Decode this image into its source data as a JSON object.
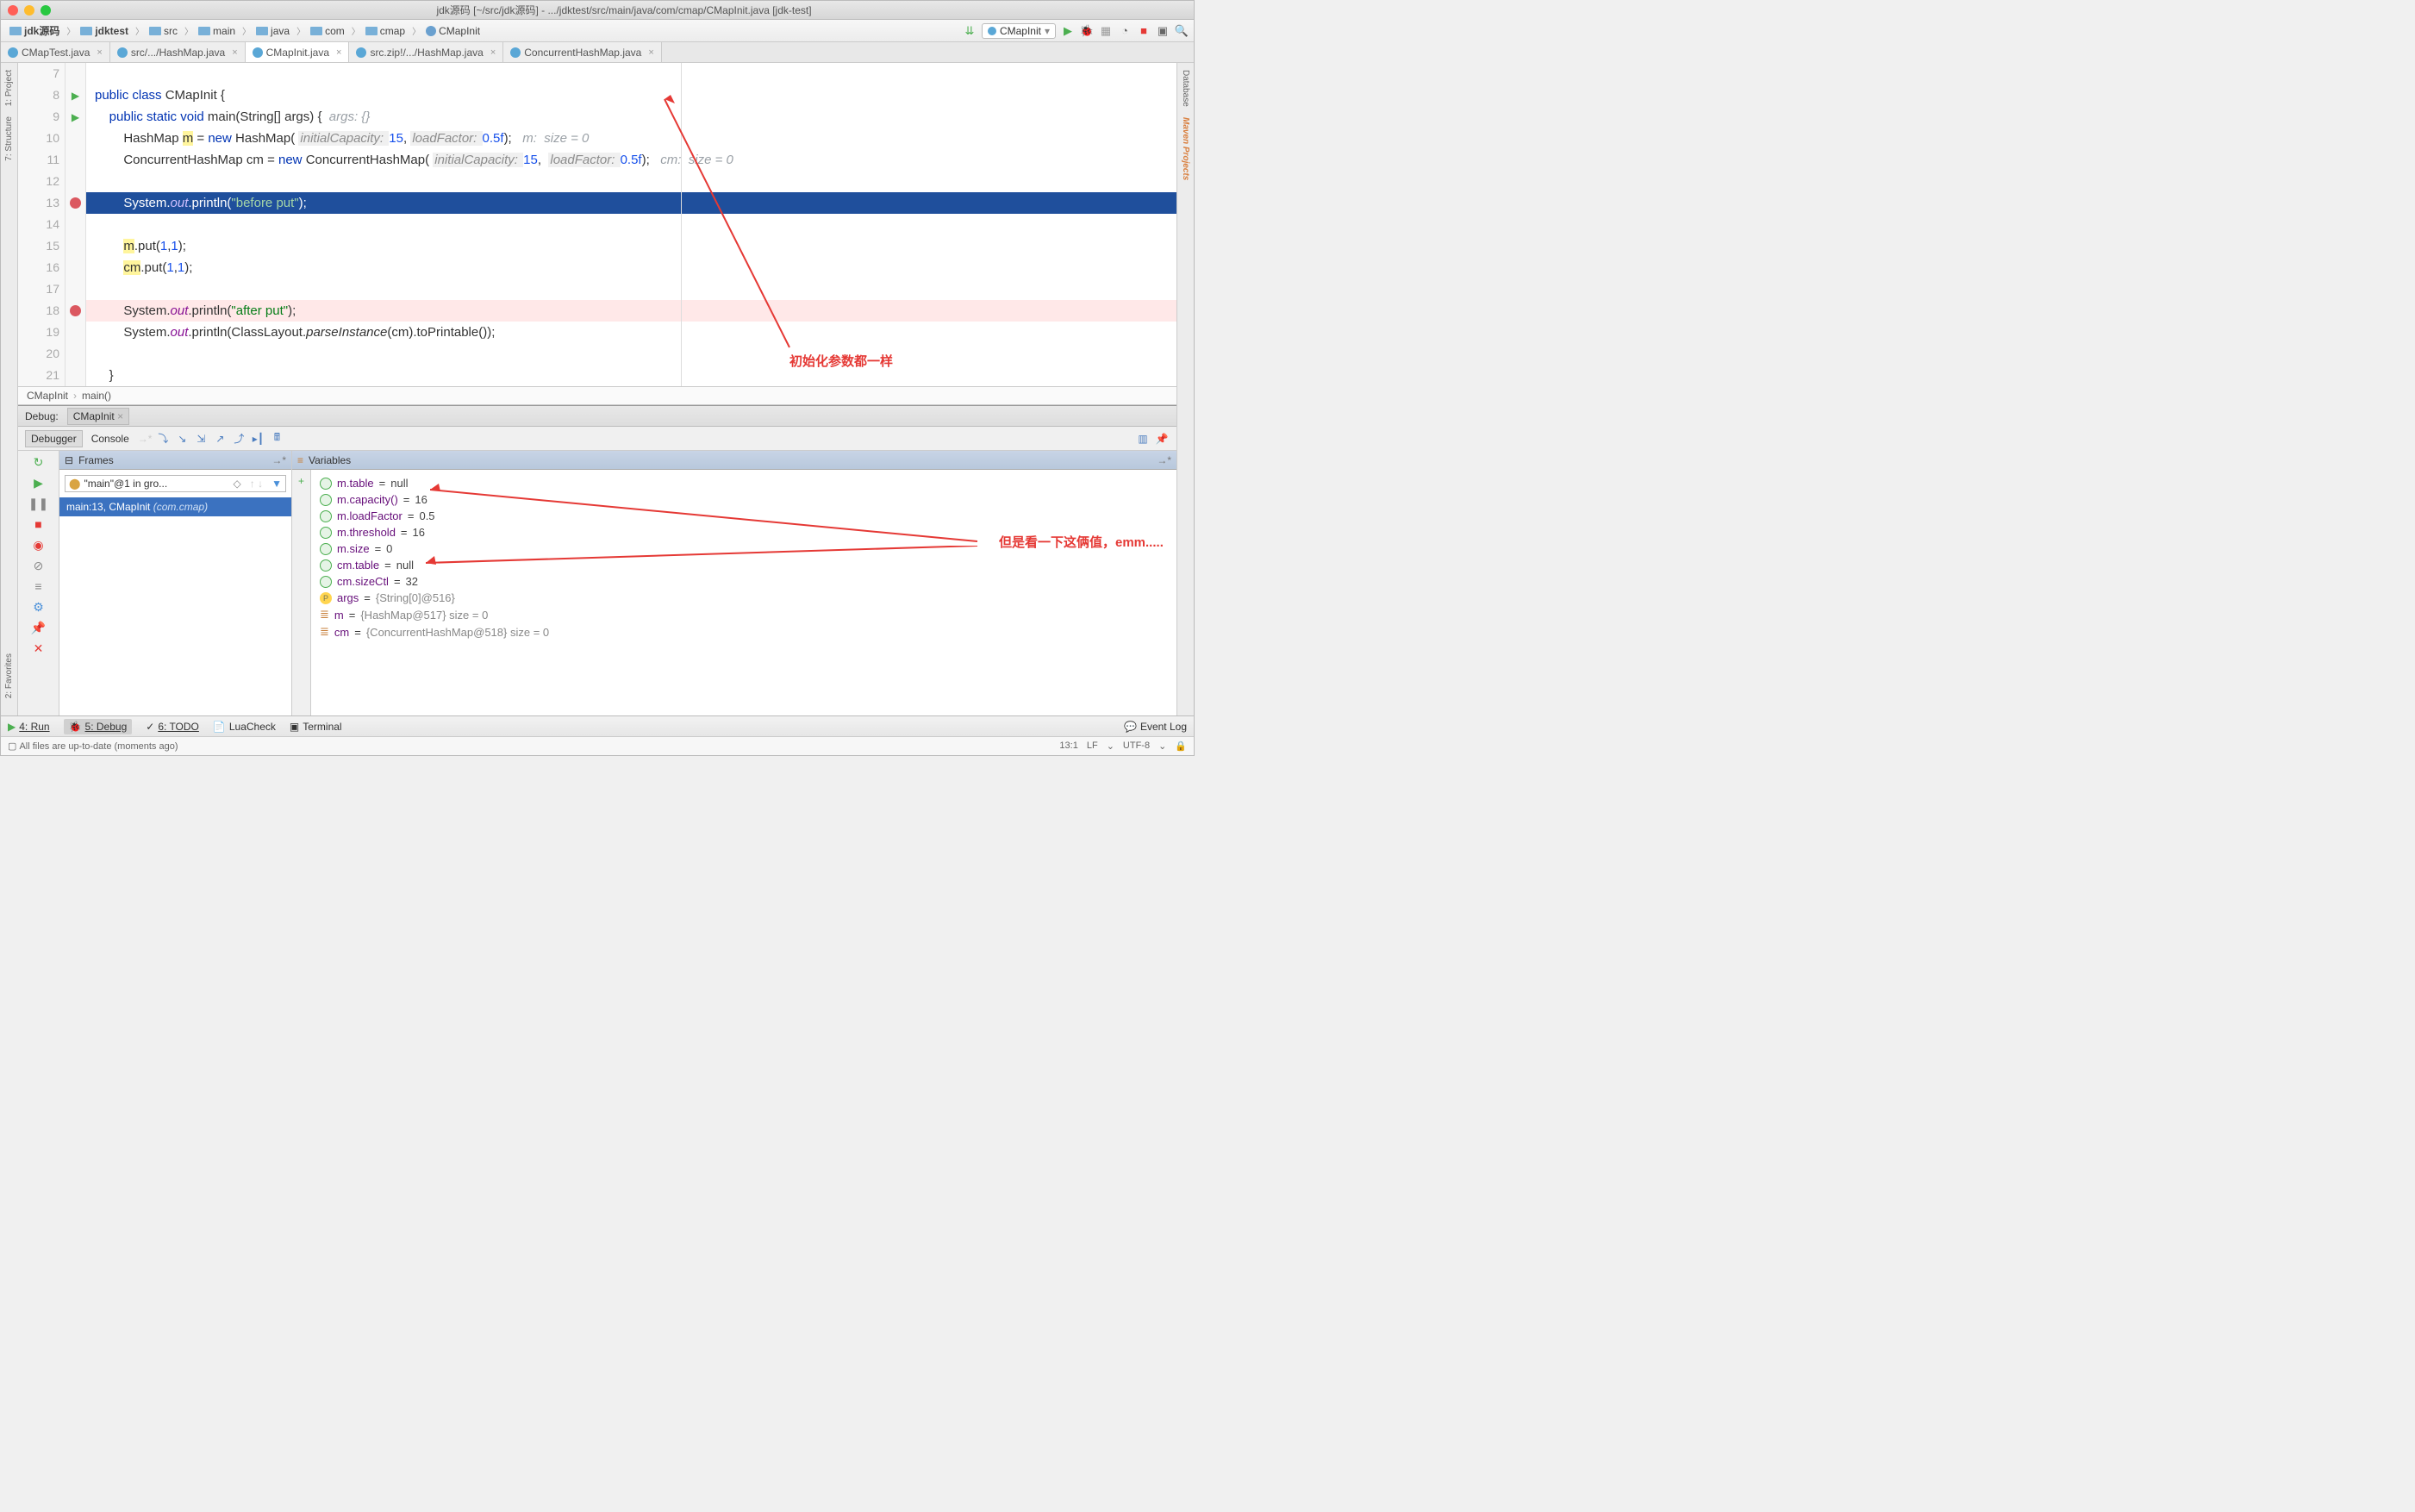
{
  "title": "jdk源码 [~/src/jdk源码] - .../jdktest/src/main/java/com/cmap/CMapInit.java [jdk-test]",
  "breadcrumbs": [
    "jdk源码",
    "jdktest",
    "src",
    "main",
    "java",
    "com",
    "cmap",
    "CMapInit"
  ],
  "run_config": "CMapInit",
  "tabs": [
    {
      "label": "CMapTest.java",
      "active": false
    },
    {
      "label": "src/.../HashMap.java",
      "active": false
    },
    {
      "label": "CMapInit.java",
      "active": true
    },
    {
      "label": "src.zip!/.../HashMap.java",
      "active": false
    },
    {
      "label": "ConcurrentHashMap.java",
      "active": false
    }
  ],
  "side_left": {
    "project": "1: Project",
    "structure": "7: Structure",
    "favorites": "2: Favorites"
  },
  "side_right": {
    "database": "Database",
    "maven": "Maven Projects"
  },
  "editor_nav": {
    "class": "CMapInit",
    "method": "main()"
  },
  "code": {
    "l7": "7",
    "l8": "8",
    "l9": "9",
    "l10": "10",
    "l11": "11",
    "l12": "12",
    "l13": "13",
    "l14": "14",
    "l15": "15",
    "l16": "16",
    "l17": "17",
    "l18": "18",
    "l19": "19",
    "l20": "20",
    "l21": "21",
    "c8": "public class CMapInit {",
    "c9_pre": "    public static void main(String[] args) {  ",
    "c9_hint": "args: {}",
    "c10_pre": "        HashMap ",
    "c10_m": "m",
    "c10_mid": " = new HashMap( ",
    "c10_h1": "initialCapacity: ",
    "c10_v1": "15",
    "c10_c": ", ",
    "c10_h2": "loadFactor: ",
    "c10_v2": "0.5f",
    "c10_end": ");   ",
    "c10_inline": "m:  size = 0",
    "c11_pre": "        ConcurrentHashMap cm = new ConcurrentHashMap( ",
    "c11_h1": "initialCapacity: ",
    "c11_v1": "15",
    "c11_c": ",  ",
    "c11_h2": "loadFactor: ",
    "c11_v2": "0.5f",
    "c11_end": ");   ",
    "c11_inline": "cm:  size = 0",
    "c13_pre": "        System.",
    "c13_out": "out",
    "c13_mid": ".println(",
    "c13_str": "\"before put\"",
    "c13_end": ");",
    "c15_pre": "        ",
    "c15_m": "m",
    "c15_mid": ".put(",
    "c15_a": "1",
    "c15_c": ",",
    "c15_b": "1",
    "c15_end": ");",
    "c16_pre": "        ",
    "c16_m": "cm",
    "c16_mid": ".put(",
    "c16_a": "1",
    "c16_c": ",",
    "c16_b": "1",
    "c16_end": ");",
    "c18_pre": "        System.",
    "c18_out": "out",
    "c18_mid": ".println(",
    "c18_str": "\"after put\"",
    "c18_end": ");",
    "c19_pre": "        System.",
    "c19_out": "out",
    "c19_mid": ".println(ClassLayout.",
    "c19_fn": "parseInstance",
    "c19_end": "(cm).toPrintable());",
    "c21": "    }"
  },
  "debug": {
    "title": "Debug:",
    "session": "CMapInit",
    "tabs": {
      "debugger": "Debugger",
      "console": "Console"
    },
    "frames_label": "Frames",
    "vars_label": "Variables",
    "thread": "\"main\"@1 in gro...",
    "frame": {
      "loc": "main:13, CMapInit",
      "pkg": "(com.cmap)"
    },
    "vars": [
      {
        "k": "w",
        "t": "m.table = null"
      },
      {
        "k": "w",
        "t": "m.capacity() = 16"
      },
      {
        "k": "w",
        "t": "m.loadFactor = 0.5"
      },
      {
        "k": "w",
        "t": "m.threshold = 16"
      },
      {
        "k": "w",
        "t": "m.size = 0"
      },
      {
        "k": "w",
        "t": "cm.table = null"
      },
      {
        "k": "w",
        "t": "cm.sizeCtl = 32"
      },
      {
        "k": "p",
        "t": "args = {String[0]@516}"
      },
      {
        "k": "o",
        "t": "m = {HashMap@517}  size = 0"
      },
      {
        "k": "o",
        "t": "cm = {ConcurrentHashMap@518}  size = 0"
      }
    ]
  },
  "annotations": {
    "top": "初始化参数都一样",
    "bottom": "但是看一下这俩值，emm....."
  },
  "bottom_tools": {
    "run": "4: Run",
    "debug": "5: Debug",
    "todo": "6: TODO",
    "lua": "LuaCheck",
    "terminal": "Terminal",
    "eventlog": "Event Log"
  },
  "status": {
    "msg": "All files are up-to-date (moments ago)",
    "pos": "13:1",
    "le": "LF",
    "enc": "UTF-8"
  }
}
